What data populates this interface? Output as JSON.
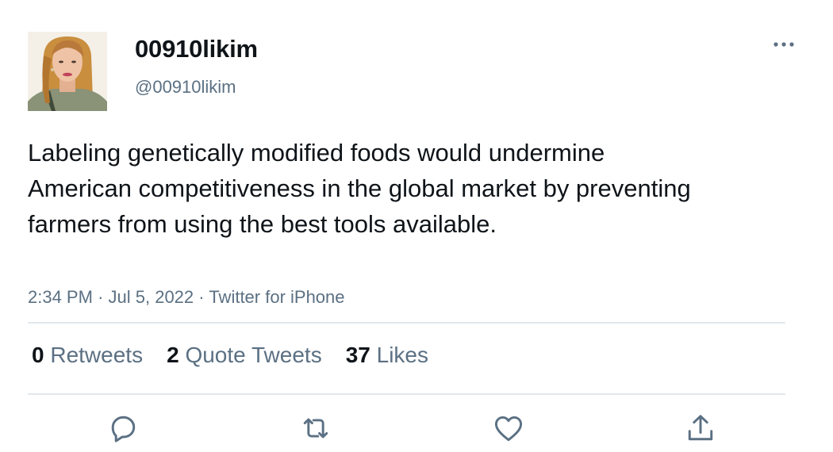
{
  "tweet": {
    "display_name": "00910likim",
    "handle": "@00910likim",
    "text": "Labeling genetically modified foods would undermine American competitiveness in the global market by preventing farmers from using the best tools available.",
    "time": "2:34 PM",
    "date": "Jul 5, 2022",
    "source": "Twitter for iPhone",
    "separator": "·"
  },
  "stats": {
    "retweets": {
      "count": "0",
      "label": "Retweets"
    },
    "quote_tweets": {
      "count": "2",
      "label": "Quote Tweets"
    },
    "likes": {
      "count": "37",
      "label": "Likes"
    }
  },
  "icons": {
    "more": "more-horizontal-icon",
    "reply": "reply-icon",
    "retweet": "retweet-icon",
    "like": "heart-icon",
    "share": "share-icon"
  },
  "colors": {
    "text_primary": "#0f1419",
    "text_secondary": "#5b7083",
    "divider": "#e1e8ed"
  }
}
